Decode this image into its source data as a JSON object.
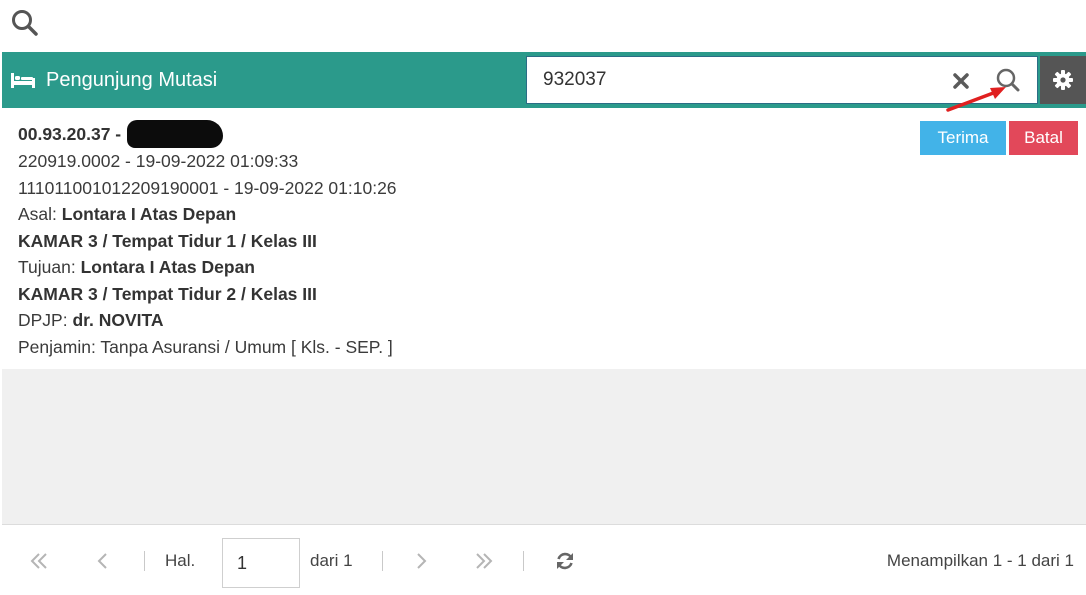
{
  "header": {
    "title": "Pengunjung Mutasi",
    "title_icon": "bed-icon",
    "search_value": "932037",
    "icons": {
      "clear": "close-icon",
      "search": "search-icon",
      "settings": "gear-icon"
    },
    "color": "#2b9a8b"
  },
  "record": {
    "id_prefix": "00.93.20.37 -",
    "line2": "220919.0002 - 19-09-2022 01:09:33",
    "line3": "11101100101220919000​1 - 19-09-2022 01:10:26",
    "asal_label": "Asal:",
    "asal_value": "Lontara I Atas Depan",
    "asal_room": "KAMAR 3 / Tempat Tidur 1 / Kelas III",
    "tujuan_label": "Tujuan:",
    "tujuan_value": "Lontara I Atas Depan",
    "tujuan_room": "KAMAR 3 / Tempat Tidur 2 / Kelas III",
    "dpjp_label": "DPJP:",
    "dpjp_value": "dr. NOVITA",
    "penjamin": "Penjamin: Tanpa Asuransi / Umum [ Kls. - SEP. ]"
  },
  "actions": {
    "accept": "Terima",
    "cancel": "Batal",
    "accept_color": "#42b3e8",
    "cancel_color": "#e2485a"
  },
  "pagination": {
    "page_label": "Hal.",
    "page_value": "1",
    "of_label": "dari 1",
    "status": "Menampilkan 1 - 1 dari 1"
  }
}
